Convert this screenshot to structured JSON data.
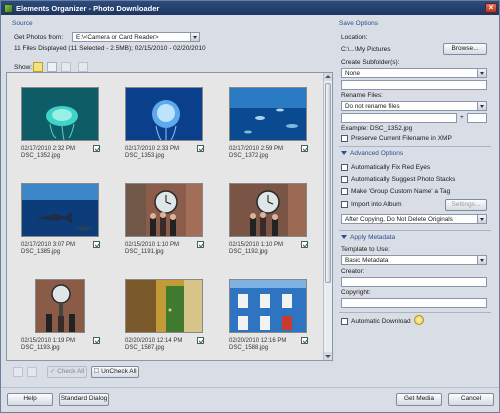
{
  "window": {
    "title": "Elements Organizer - Photo Downloader"
  },
  "source": {
    "section_label": "Source",
    "get_photos_label": "Get Photos from:",
    "get_photos_value": "E:\\<Camera or Card Reader>",
    "files_info": "11 Files Displayed (11 Selected - 2.5MB); 02/15/2010 - 02/20/2010",
    "show_label": "Show:"
  },
  "photos": [
    {
      "date": "02/17/2010 2:32 PM",
      "name": "DSC_1352.jpg"
    },
    {
      "date": "02/17/2010 2:33 PM",
      "name": "DSC_1353.jpg"
    },
    {
      "date": "02/17/2010 2:59 PM",
      "name": "DSC_1372.jpg"
    },
    {
      "date": "02/17/2010 3:07 PM",
      "name": "DSC_1385.jpg"
    },
    {
      "date": "02/15/2010 1:10 PM",
      "name": "DSC_1191.jpg"
    },
    {
      "date": "02/15/2010 1:10 PM",
      "name": "DSC_1192.jpg"
    },
    {
      "date": "02/15/2010 1:19 PM",
      "name": "DSC_1193.jpg"
    },
    {
      "date": "02/20/2010 12:14 PM",
      "name": "DSC_1587.jpg"
    },
    {
      "date": "02/20/2010 12:16 PM",
      "name": "DSC_1588.jpg"
    }
  ],
  "bottom_tools": {
    "check_all": "Check All",
    "uncheck_all": "UnCheck All"
  },
  "save_options": {
    "section_label": "Save Options",
    "location_label": "Location:",
    "location_value": "C:\\...\\My Pictures",
    "browse_label": "Browse...",
    "subfolder_label": "Create Subfolder(s):",
    "subfolder_value": "None",
    "rename_label": "Rename Files:",
    "rename_value": "Do not rename files",
    "plus_sign": "+",
    "example_text": "Example: DSC_1352.jpg",
    "preserve_label": "Preserve Current Filename in XMP"
  },
  "advanced": {
    "section_label": "Advanced Options",
    "fix_red_eyes": "Automatically Fix Red Eyes",
    "suggest_stacks": "Automatically Suggest Photo Stacks",
    "custom_name_tag": "Make 'Group Custom Name' a Tag",
    "import_album": "Import into Album",
    "settings_label": "Settings...",
    "after_copy_value": "After Copying, Do Not Delete Originals"
  },
  "metadata": {
    "section_label": "Apply Metadata",
    "template_label": "Template to Use:",
    "template_value": "Basic Metadata",
    "creator_label": "Creator:",
    "copyright_label": "Copyright:",
    "auto_download_label": "Automatic Download"
  },
  "footer": {
    "help": "Help",
    "standard_dialog": "Standard Dialog",
    "get_media": "Get Media",
    "cancel": "Cancel"
  }
}
